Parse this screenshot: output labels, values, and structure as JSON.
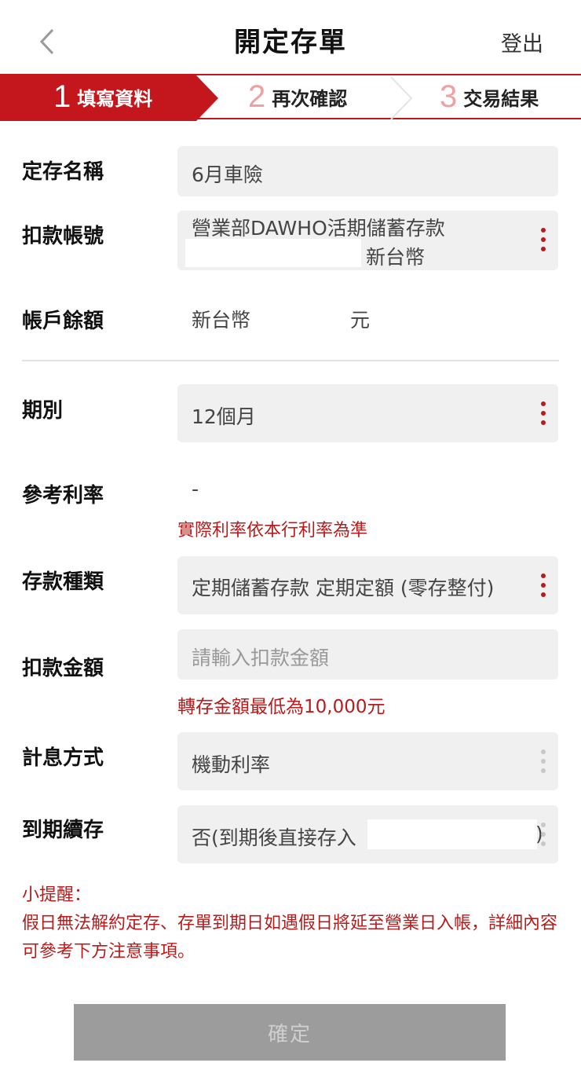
{
  "header": {
    "title": "開定存單",
    "logout_label": "登出"
  },
  "stepper": {
    "steps": [
      {
        "num": "1",
        "label": "填寫資料"
      },
      {
        "num": "2",
        "label": "再次確認"
      },
      {
        "num": "3",
        "label": "交易結果"
      }
    ]
  },
  "form": {
    "name": {
      "label": "定存名稱",
      "value": "6月車險"
    },
    "account": {
      "label": "扣款帳號",
      "line1": "營業部DAWHO活期儲蓄存款",
      "line2": "新台幣"
    },
    "balance": {
      "label": "帳戶餘額",
      "currency": "新台幣",
      "unit": "元"
    },
    "period": {
      "label": "期別",
      "value": "12個月"
    },
    "rate": {
      "label": "參考利率",
      "value": "-",
      "note": "實際利率依本行利率為準"
    },
    "deposit_type": {
      "label": "存款種類",
      "value": "定期儲蓄存款 定期定額 (零存整付)"
    },
    "amount": {
      "label": "扣款金額",
      "placeholder": "請輸入扣款金額",
      "note": "轉存金額最低為10,000元"
    },
    "interest": {
      "label": "計息方式",
      "value": "機動利率"
    },
    "renewal": {
      "label": "到期續存",
      "value_prefix": "否(到期後直接存入",
      "value_suffix": ")"
    }
  },
  "reminder": {
    "title": "小提醒：",
    "text": "假日無法解約定存、存單到期日如遇假日將延至營業日入帳，詳細內容可參考下方注意事項。"
  },
  "confirm_label": "確定",
  "colors": {
    "accent": "#c4171d",
    "note": "#b71c1c"
  }
}
